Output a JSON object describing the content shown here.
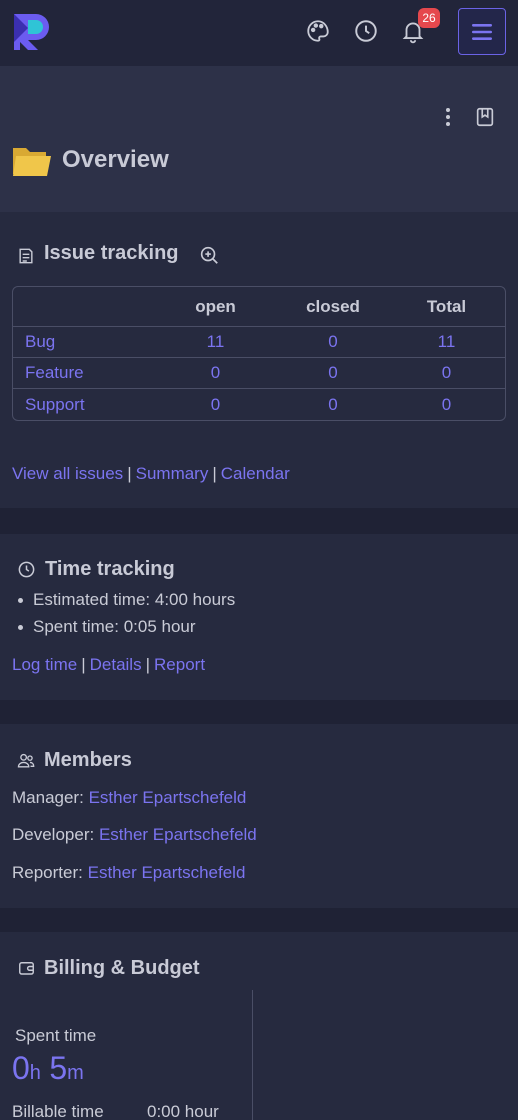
{
  "topbar": {
    "logo": "redmine-r-logo",
    "icons": [
      "palette-icon",
      "clock-icon",
      "bell-icon",
      "menu-icon"
    ],
    "notification_count": "26"
  },
  "page": {
    "title": "Overview",
    "icons": [
      "kebab-menu-icon",
      "bookmark-icon",
      "folder-icon"
    ]
  },
  "issue_tracking": {
    "title": "Issue tracking",
    "columns": [
      "",
      "open",
      "closed",
      "Total"
    ],
    "rows": [
      {
        "tracker": "Bug",
        "open": "11",
        "closed": "0",
        "total": "11"
      },
      {
        "tracker": "Feature",
        "open": "0",
        "closed": "0",
        "total": "0"
      },
      {
        "tracker": "Support",
        "open": "0",
        "closed": "0",
        "total": "0"
      }
    ],
    "links": {
      "view_all": "View all issues",
      "summary": "Summary",
      "calendar": "Calendar",
      "separator": "|"
    }
  },
  "time_tracking": {
    "title": "Time tracking",
    "estimated": "Estimated time: 4:00 hours",
    "spent": "Spent time: 0:05 hour",
    "links": {
      "log_time": "Log time",
      "details": "Details",
      "report": "Report",
      "separator": "|"
    }
  },
  "members": {
    "title": "Members",
    "rows": [
      {
        "role": "Manager:",
        "name": "Esther Epartschefeld"
      },
      {
        "role": "Developer:",
        "name": "Esther Epartschefeld"
      },
      {
        "role": "Reporter:",
        "name": "Esther Epartschefeld"
      }
    ]
  },
  "billing": {
    "title": "Billing & Budget",
    "spent_label": "Spent time",
    "hours": "0",
    "hours_unit": "h",
    "minutes": "5",
    "minutes_unit": "m",
    "billable_label": "Billable time",
    "billable_value": "0:00 hour"
  },
  "colors": {
    "background": "#1f2235",
    "card": "#262a3f",
    "header": "#2d3148",
    "link": "#7b74f0",
    "badge": "#e5484d",
    "folder": "#f0c64a"
  }
}
